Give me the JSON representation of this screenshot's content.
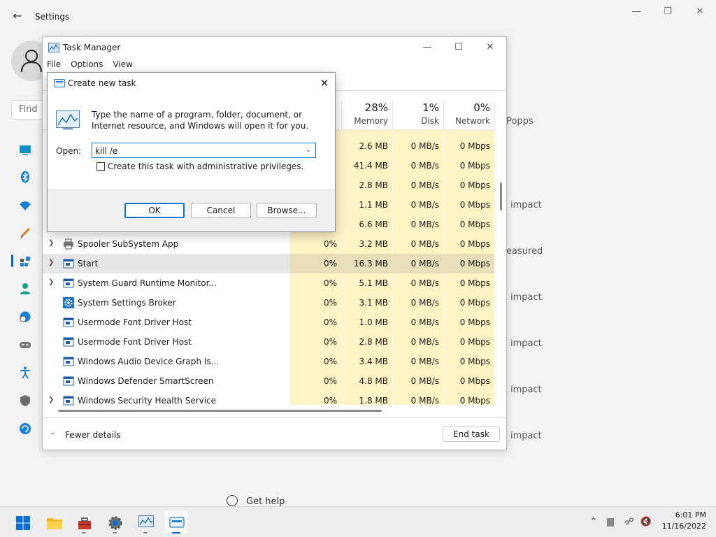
{
  "settings": {
    "title": "Settings",
    "search_placeholder": "Find a",
    "right_texts": [
      "Popps",
      "impact",
      "easured",
      "impact",
      "impact",
      "impact",
      "impact"
    ],
    "get_help": "Get help"
  },
  "taskmgr": {
    "title": "Task Manager",
    "menu": [
      "File",
      "Options",
      "View"
    ],
    "columns": [
      {
        "pct": "28%",
        "name": "Memory"
      },
      {
        "pct": "1%",
        "name": "Disk"
      },
      {
        "pct": "0%",
        "name": "Network"
      }
    ],
    "rows": [
      {
        "name": "",
        "expand": false,
        "cpu": "",
        "mem": "2.6 MB",
        "disk": "0 MB/s",
        "net": "0 Mbps",
        "icon": "window-icon"
      },
      {
        "name": "",
        "expand": false,
        "cpu": "",
        "mem": "41.4 MB",
        "disk": "0 MB/s",
        "net": "0 Mbps",
        "icon": "window-icon"
      },
      {
        "name": "",
        "expand": false,
        "cpu": "",
        "mem": "2.8 MB",
        "disk": "0 MB/s",
        "net": "0 Mbps",
        "icon": "window-icon"
      },
      {
        "name": "",
        "expand": false,
        "cpu": "",
        "mem": "1.1 MB",
        "disk": "0 MB/s",
        "net": "0 Mbps",
        "icon": "window-icon"
      },
      {
        "name": "",
        "expand": false,
        "cpu": "",
        "mem": "6.6 MB",
        "disk": "0 MB/s",
        "net": "0 Mbps",
        "icon": "window-icon"
      },
      {
        "name": "Spooler SubSystem App",
        "expand": true,
        "cpu": "0%",
        "mem": "3.2 MB",
        "disk": "0 MB/s",
        "net": "0 Mbps",
        "icon": "printer-icon"
      },
      {
        "name": "Start",
        "expand": true,
        "cpu": "0%",
        "mem": "16.3 MB",
        "disk": "0 MB/s",
        "net": "0 Mbps",
        "icon": "window-icon",
        "selected": true
      },
      {
        "name": "System Guard Runtime Monitor...",
        "expand": true,
        "cpu": "0%",
        "mem": "5.1 MB",
        "disk": "0 MB/s",
        "net": "0 Mbps",
        "icon": "window-icon"
      },
      {
        "name": "System Settings Broker",
        "expand": false,
        "cpu": "0%",
        "mem": "3.1 MB",
        "disk": "0 MB/s",
        "net": "0 Mbps",
        "icon": "gear-icon"
      },
      {
        "name": "Usermode Font Driver Host",
        "expand": false,
        "cpu": "0%",
        "mem": "1.0 MB",
        "disk": "0 MB/s",
        "net": "0 Mbps",
        "icon": "window-icon"
      },
      {
        "name": "Usermode Font Driver Host",
        "expand": false,
        "cpu": "0%",
        "mem": "2.8 MB",
        "disk": "0 MB/s",
        "net": "0 Mbps",
        "icon": "window-icon"
      },
      {
        "name": "Windows Audio Device Graph Is...",
        "expand": false,
        "cpu": "0%",
        "mem": "3.4 MB",
        "disk": "0 MB/s",
        "net": "0 Mbps",
        "icon": "window-icon"
      },
      {
        "name": "Windows Defender SmartScreen",
        "expand": false,
        "cpu": "0%",
        "mem": "4.8 MB",
        "disk": "0 MB/s",
        "net": "0 Mbps",
        "icon": "window-icon"
      },
      {
        "name": "Windows Security Health Service",
        "expand": true,
        "cpu": "0%",
        "mem": "1.8 MB",
        "disk": "0 MB/s",
        "net": "0 Mbps",
        "icon": "window-icon"
      }
    ],
    "fewer_details": "Fewer details",
    "end_task": "End task"
  },
  "run_dialog": {
    "title": "Create new task",
    "description": "Type the name of a program, folder, document, or Internet resource, and Windows will open it for you.",
    "open_label": "Open:",
    "open_value": "kill /e",
    "admin_label": "Create this task with administrative privileges.",
    "ok": "OK",
    "cancel": "Cancel",
    "browse": "Browse..."
  },
  "taskbar": {
    "apps": [
      "start-icon",
      "file-explorer-icon",
      "toolbox-icon",
      "settings-icon",
      "task-manager-icon",
      "run-dialog-icon"
    ],
    "time": "6:01 PM",
    "date": "11/16/2022"
  },
  "colors": {
    "accent": "#0067c0",
    "cpu_highlight": "#fff4c4",
    "selection": "#e6e6e6"
  }
}
